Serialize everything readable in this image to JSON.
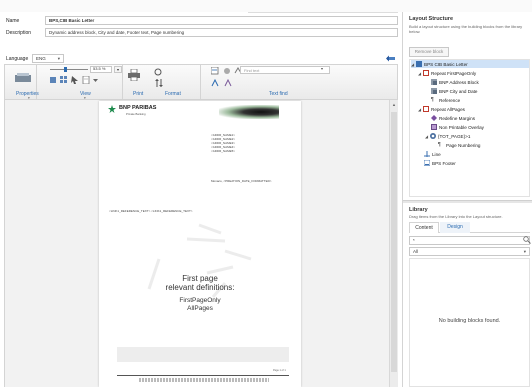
{
  "form": {
    "name_label": "Name",
    "name_value": "BPS,CIB Basic Letter",
    "description_label": "Description",
    "description_value": "Dynamic address block, City and date, Footer text, Page numbering",
    "language_label": "Language",
    "language_value": "ENG"
  },
  "toolbar": {
    "zoom_value": "53.5 %",
    "find_placeholder": "Find text",
    "tabs": [
      "Properties",
      "View",
      "Print",
      "Format",
      "Text find"
    ]
  },
  "document": {
    "logo_text": "BNP PARIBAS",
    "logo_sub": "Private Banking",
    "address_lines": [
      "<ADDR_NAME1>",
      "<ADDR_NAME2>",
      "<ADDR_NAME3>",
      "<ADDR_NAME4>",
      "<ADDR_NAME5>"
    ],
    "date_line": "Monaco, <PREATION_DATE_FORMATTED>",
    "ref_line": "<LINK1_REFERENCE_TEXT> <LINK1_REFERENCE_TEXT>",
    "overlay_title_1": "First page",
    "overlay_title_2": "relevant definitions:",
    "overlay_item_1": "FirstPageOnly",
    "overlay_item_2": "AllPages",
    "page_number": "Page 1 of 1"
  },
  "layout": {
    "title": "Layout Structure",
    "description": "Build a layout structure using the building blocks from the library below.",
    "remove_button": "Remove block",
    "tree": [
      {
        "label": "BPS CIB Basic Letter",
        "icon": "document-icon",
        "level": 0,
        "expanded": true
      },
      {
        "label": "Repeat FirstPageOnly",
        "icon": "repeat-icon",
        "level": 1,
        "expanded": true
      },
      {
        "label": "BNP Address Block",
        "icon": "block-icon",
        "level": 2
      },
      {
        "label": "BNP City and Date",
        "icon": "block-icon",
        "level": 2
      },
      {
        "label": "Reference",
        "icon": "paragraph-icon",
        "level": 2
      },
      {
        "label": "Repeat AllPages",
        "icon": "repeat-icon",
        "level": 1,
        "expanded": true
      },
      {
        "label": "Redefine Margins",
        "icon": "margins-icon",
        "level": 2
      },
      {
        "label": "Non Printable Overlay",
        "icon": "overlay-icon",
        "level": 2
      },
      {
        "label": "{TOT_PAGE}>1",
        "icon": "condition-icon",
        "level": 2,
        "expanded": true
      },
      {
        "label": "Page Numbering",
        "icon": "paragraph-icon",
        "level": 3
      },
      {
        "label": "Line",
        "icon": "line-icon",
        "level": 1
      },
      {
        "label": "BPS Footer",
        "icon": "footer-icon",
        "level": 1
      }
    ]
  },
  "library": {
    "title": "Library",
    "description": "Drag items from the Library into the Layout structure.",
    "tabs": [
      "Content",
      "Design"
    ],
    "search_value": "*",
    "filter_value": "All",
    "empty_message": "No building blocks found."
  }
}
